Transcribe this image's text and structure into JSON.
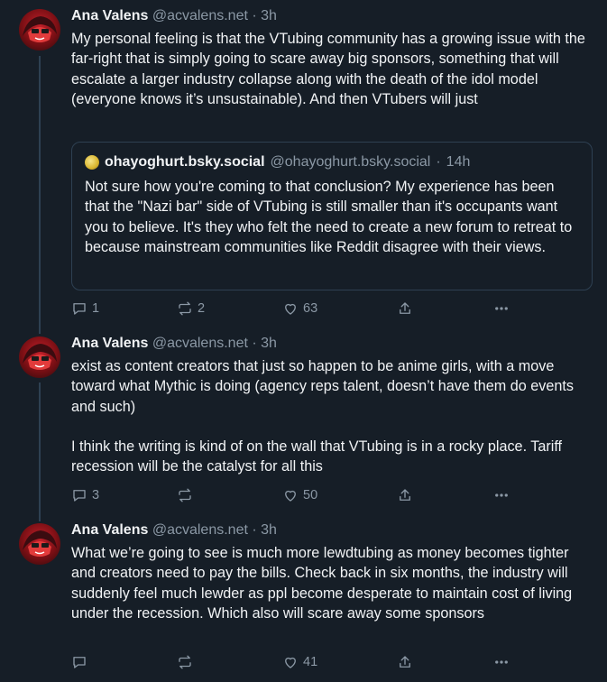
{
  "posts": [
    {
      "author": "Ana Valens",
      "handle": "@acvalens.net",
      "separator": "·",
      "time": "3h",
      "text": [
        "My personal feeling is that the VTubing community has a growing issue with the far-right that is simply going to scare away big sponsors, something that will escalate a larger industry collapse along with the death of the idol model (everyone knows it’s unsustainable). And then VTubers will just"
      ],
      "quote": {
        "author": "ohayoghurt.bsky.social",
        "handle": "@ohayoghurt.bsky.social",
        "separator": "·",
        "time": "14h",
        "text": "Not sure how you're coming to that conclusion?  My experience has been that the \"Nazi bar\" side of VTubing is still smaller than it's occupants want you to believe.  It's they who felt the need to create a new forum to retreat to because mainstream communities like Reddit disagree with their views."
      },
      "replies": "1",
      "reposts": "2",
      "likes": "63"
    },
    {
      "author": "Ana Valens",
      "handle": "@acvalens.net",
      "separator": "·",
      "time": "3h",
      "text": [
        "exist as content creators that just so happen to be anime girls, with a move toward what Mythic is doing (agency reps talent, doesn’t have them do events and such)",
        "I think the writing is kind of on the wall that VTubing is in a rocky place. Tariff recession will be the catalyst for all this"
      ],
      "replies": "3",
      "reposts": "",
      "likes": "50"
    },
    {
      "author": "Ana Valens",
      "handle": "@acvalens.net",
      "separator": "·",
      "time": "3h",
      "text": [
        "What we’re going to see is much more lewdtubing as money becomes tighter and creators need to pay the bills. Check back in six months, the industry will suddenly feel much lewder as ppl become desperate to maintain cost of living under the recession. Which also will scare away some sponsors"
      ],
      "replies": "",
      "reposts": "",
      "likes": "41"
    }
  ],
  "icons": {
    "reply": "reply-icon",
    "repost": "repost-icon",
    "like": "heart-icon",
    "share": "share-icon",
    "more": "more-icon"
  }
}
